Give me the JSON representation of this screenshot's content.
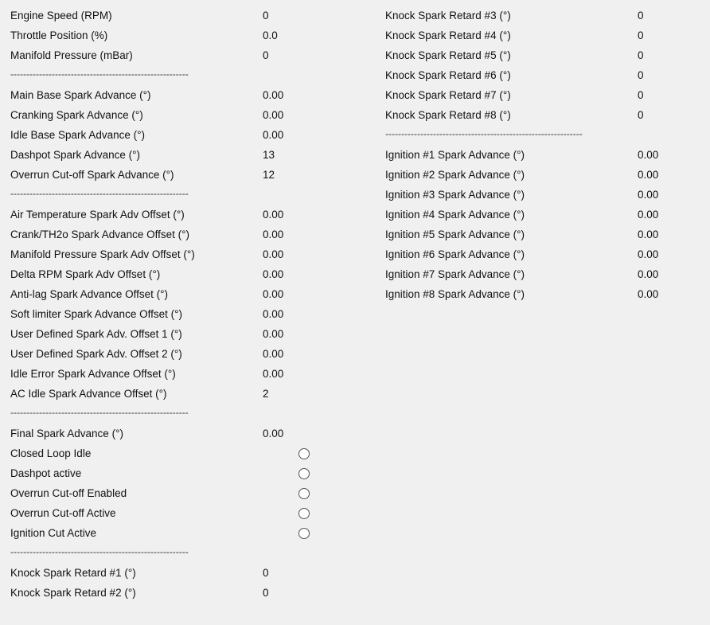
{
  "left": {
    "group1": [
      {
        "label": "Engine Speed (RPM)",
        "value": "0"
      },
      {
        "label": "Throttle Position (%)",
        "value": "0.0"
      },
      {
        "label": "Manifold Pressure (mBar)",
        "value": "0"
      }
    ],
    "separator": "--------------------------------------------------------",
    "group2": [
      {
        "label": "Main Base Spark Advance (°)",
        "value": "0.00"
      },
      {
        "label": "Cranking Spark Advance (°)",
        "value": "0.00"
      },
      {
        "label": "Idle Base Spark Advance (°)",
        "value": "0.00"
      },
      {
        "label": "Dashpot Spark Advance (°)",
        "value": "13"
      },
      {
        "label": "Overrun Cut-off Spark Advance (°)",
        "value": "12"
      }
    ],
    "group3": [
      {
        "label": "Air Temperature Spark Adv Offset (°)",
        "value": "0.00"
      },
      {
        "label": "Crank/TH2o Spark Advance Offset (°)",
        "value": "0.00"
      },
      {
        "label": "Manifold Pressure Spark Adv Offset (°)",
        "value": "0.00"
      },
      {
        "label": "Delta RPM Spark Adv Offset (°)",
        "value": "0.00"
      },
      {
        "label": "Anti-lag Spark Advance Offset (°)",
        "value": "0.00"
      },
      {
        "label": "Soft limiter Spark Advance Offset (°)",
        "value": "0.00"
      },
      {
        "label": "User Defined Spark Adv. Offset 1 (°)",
        "value": "0.00"
      },
      {
        "label": "User Defined Spark Adv. Offset 2 (°)",
        "value": "0.00"
      },
      {
        "label": "Idle Error Spark Advance Offset (°)",
        "value": "0.00"
      },
      {
        "label": "AC Idle Spark Advance Offset (°)",
        "value": "2"
      }
    ],
    "final": {
      "label": "Final Spark Advance (°)",
      "value": "0.00"
    },
    "flags": [
      {
        "label": "Closed Loop Idle"
      },
      {
        "label": "Dashpot active"
      },
      {
        "label": "Overrun Cut-off Enabled"
      },
      {
        "label": "Overrun Cut-off Active"
      },
      {
        "label": "Ignition Cut Active"
      }
    ],
    "group5": [
      {
        "label": "Knock Spark Retard #1 (°)",
        "value": "0"
      },
      {
        "label": "Knock Spark Retard #2 (°)",
        "value": "0"
      }
    ]
  },
  "right": {
    "knock": [
      {
        "label": "Knock Spark Retard #3 (°)",
        "value": "0"
      },
      {
        "label": "Knock Spark Retard #4 (°)",
        "value": "0"
      },
      {
        "label": "Knock Spark Retard #5 (°)",
        "value": "0"
      },
      {
        "label": "Knock Spark Retard #6 (°)",
        "value": "0"
      },
      {
        "label": "Knock Spark Retard #7 (°)",
        "value": "0"
      },
      {
        "label": "Knock Spark Retard #8 (°)",
        "value": "0"
      }
    ],
    "separator": "--------------------------------------------------------------",
    "ignition": [
      {
        "label": "Ignition #1 Spark Advance (°)",
        "value": "0.00"
      },
      {
        "label": "Ignition #2 Spark Advance (°)",
        "value": "0.00"
      },
      {
        "label": "Ignition #3 Spark Advance (°)",
        "value": "0.00"
      },
      {
        "label": "Ignition #4 Spark Advance (°)",
        "value": "0.00"
      },
      {
        "label": "Ignition #5 Spark Advance (°)",
        "value": "0.00"
      },
      {
        "label": "Ignition #6 Spark Advance (°)",
        "value": "0.00"
      },
      {
        "label": "Ignition #7 Spark Advance (°)",
        "value": "0.00"
      },
      {
        "label": "Ignition #8 Spark Advance (°)",
        "value": "0.00"
      }
    ]
  }
}
